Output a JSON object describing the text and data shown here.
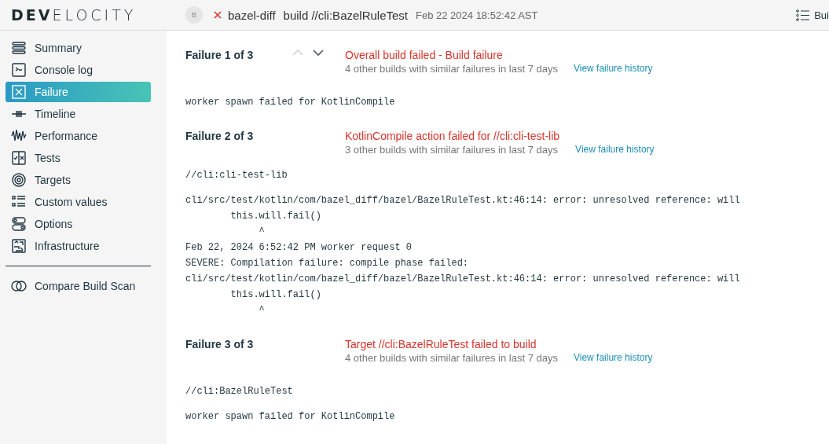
{
  "header": {
    "logo": "**DEV**ELOCITY",
    "avatar": "B",
    "project": "bazel-diff",
    "command": "build //cli:BazelRuleTest",
    "date": "Feb 22 2024 18:52:42 AST",
    "right_button": "Bui"
  },
  "sidebar": {
    "items": [
      {
        "label": "Summary",
        "kind": "summary",
        "selected": false
      },
      {
        "label": "Console log",
        "kind": "console",
        "selected": false
      },
      {
        "label": "Failure",
        "kind": "failure",
        "selected": true
      },
      {
        "label": "Timeline",
        "kind": "timeline",
        "selected": false
      },
      {
        "label": "Performance",
        "kind": "performance",
        "selected": false
      },
      {
        "label": "Tests",
        "kind": "tests",
        "selected": false
      },
      {
        "label": "Targets",
        "kind": "targets",
        "selected": false
      },
      {
        "label": "Custom values",
        "kind": "custom",
        "selected": false
      },
      {
        "label": "Options",
        "kind": "options",
        "selected": false
      },
      {
        "label": "Infrastructure",
        "kind": "infrastructure",
        "selected": false
      }
    ],
    "footer_item": {
      "label": "Compare Build Scan",
      "kind": "compare"
    }
  },
  "failures": [
    {
      "label": "Failure 1 of 3",
      "nav": {
        "up_disabled": true,
        "down_disabled": false
      },
      "title": "Overall build failed - Build failure",
      "similar": "4 other builds with similar failures in last 7 days",
      "link": "View failure history",
      "blocks": [
        "worker spawn failed for KotlinCompile"
      ]
    },
    {
      "label": "Failure 2 of 3",
      "title": "KotlinCompile action failed for //cli:cli-test-lib",
      "similar": "3 other builds with similar failures in last 7 days",
      "link": "View failure history",
      "blocks": [
        "//cli:cli-test-lib",
        "cli/src/test/kotlin/com/bazel_diff/bazel/BazelRuleTest.kt:46:14: error: unresolved reference: will\n        this.will.fail()\n             ^\nFeb 22, 2024 6:52:42 PM worker request 0\nSEVERE: Compilation failure: compile phase failed:\ncli/src/test/kotlin/com/bazel_diff/bazel/BazelRuleTest.kt:46:14: error: unresolved reference: will\n        this.will.fail()\n             ^"
      ]
    },
    {
      "label": "Failure 3 of 3",
      "title": "Target //cli:BazelRuleTest failed to build",
      "similar": "4 other builds with similar failures in last 7 days",
      "link": "View failure history",
      "blocks": [
        "//cli:BazelRuleTest",
        "worker spawn failed for KotlinCompile"
      ]
    }
  ]
}
